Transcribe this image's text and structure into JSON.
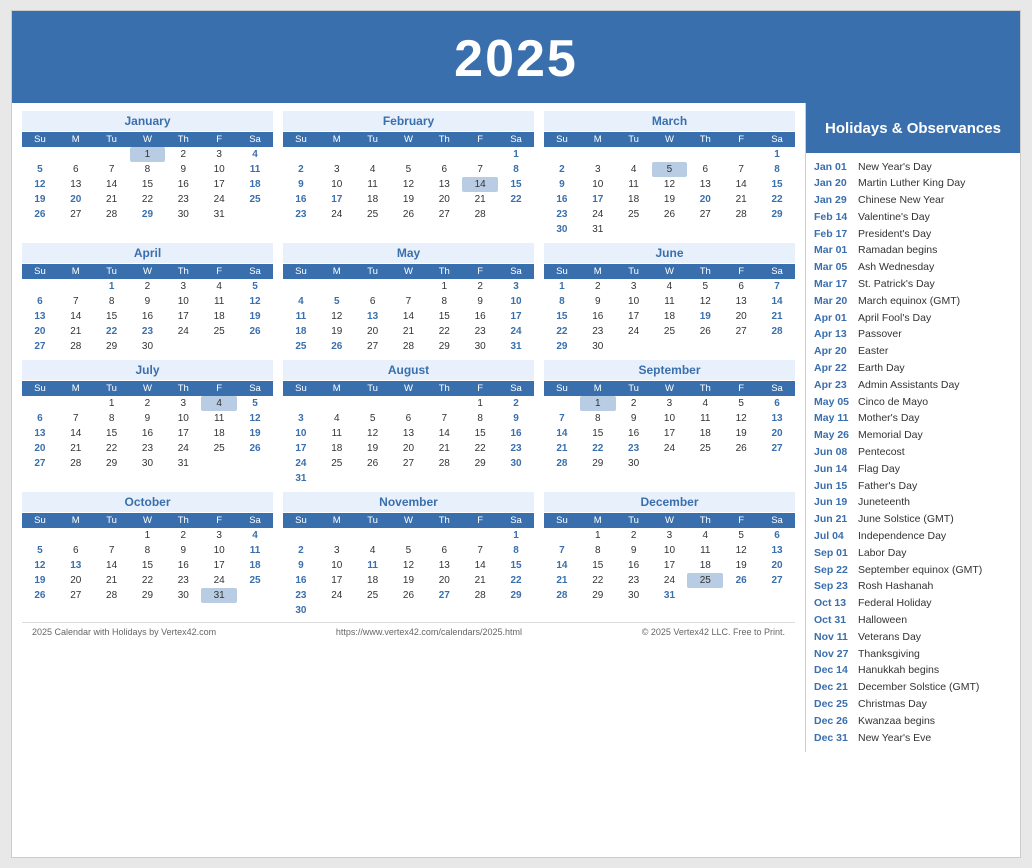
{
  "header": {
    "year": "2025"
  },
  "sidebar_header": "Holidays & Observances",
  "holidays": [
    {
      "date": "Jan 01",
      "name": "New Year's Day"
    },
    {
      "date": "Jan 20",
      "name": "Martin Luther King Day"
    },
    {
      "date": "Jan 29",
      "name": "Chinese New Year"
    },
    {
      "date": "Feb 14",
      "name": "Valentine's Day"
    },
    {
      "date": "Feb 17",
      "name": "President's Day"
    },
    {
      "date": "Mar 01",
      "name": "Ramadan begins"
    },
    {
      "date": "Mar 05",
      "name": "Ash Wednesday"
    },
    {
      "date": "Mar 17",
      "name": "St. Patrick's Day"
    },
    {
      "date": "Mar 20",
      "name": "March equinox (GMT)"
    },
    {
      "date": "Apr 01",
      "name": "April Fool's Day"
    },
    {
      "date": "Apr 13",
      "name": "Passover"
    },
    {
      "date": "Apr 20",
      "name": "Easter"
    },
    {
      "date": "Apr 22",
      "name": "Earth Day"
    },
    {
      "date": "Apr 23",
      "name": "Admin Assistants Day"
    },
    {
      "date": "May 05",
      "name": "Cinco de Mayo"
    },
    {
      "date": "May 11",
      "name": "Mother's Day"
    },
    {
      "date": "May 26",
      "name": "Memorial Day"
    },
    {
      "date": "Jun 08",
      "name": "Pentecost"
    },
    {
      "date": "Jun 14",
      "name": "Flag Day"
    },
    {
      "date": "Jun 15",
      "name": "Father's Day"
    },
    {
      "date": "Jun 19",
      "name": "Juneteenth"
    },
    {
      "date": "Jun 21",
      "name": "June Solstice (GMT)"
    },
    {
      "date": "Jul 04",
      "name": "Independence Day"
    },
    {
      "date": "Sep 01",
      "name": "Labor Day"
    },
    {
      "date": "Sep 22",
      "name": "September equinox (GMT)"
    },
    {
      "date": "Sep 23",
      "name": "Rosh Hashanah"
    },
    {
      "date": "Oct 13",
      "name": "Federal Holiday"
    },
    {
      "date": "Oct 31",
      "name": "Halloween"
    },
    {
      "date": "Nov 11",
      "name": "Veterans Day"
    },
    {
      "date": "Nov 27",
      "name": "Thanksgiving"
    },
    {
      "date": "Dec 14",
      "name": "Hanukkah begins"
    },
    {
      "date": "Dec 21",
      "name": "December Solstice (GMT)"
    },
    {
      "date": "Dec 25",
      "name": "Christmas Day"
    },
    {
      "date": "Dec 26",
      "name": "Kwanzaa begins"
    },
    {
      "date": "Dec 31",
      "name": "New Year's Eve"
    }
  ],
  "footer_left": "2025 Calendar with Holidays by Vertex42.com",
  "footer_center": "https://www.vertex42.com/calendars/2025.html",
  "footer_right": "© 2025 Vertex42 LLC. Free to Print.",
  "months": [
    {
      "name": "January",
      "weeks": [
        [
          null,
          null,
          null,
          "1h",
          "2",
          "3",
          "4"
        ],
        [
          "5",
          "6",
          "7",
          "8",
          "9",
          "10",
          "11"
        ],
        [
          "12",
          "13",
          "14",
          "15",
          "16",
          "17",
          "18"
        ],
        [
          "19",
          "20b",
          "21",
          "22",
          "23",
          "24",
          "25"
        ],
        [
          "26",
          "27",
          "28",
          "29b",
          "30",
          "31",
          null
        ]
      ]
    },
    {
      "name": "February",
      "weeks": [
        [
          null,
          null,
          null,
          null,
          null,
          null,
          "1"
        ],
        [
          "2",
          "3",
          "4",
          "5",
          "6",
          "7",
          "8"
        ],
        [
          "9",
          "10",
          "11",
          "12",
          "13",
          "14h",
          "15"
        ],
        [
          "16",
          "17b",
          "18",
          "19",
          "20",
          "21",
          "22"
        ],
        [
          "23",
          "24",
          "25",
          "26",
          "27",
          "28",
          null
        ]
      ]
    },
    {
      "name": "March",
      "weeks": [
        [
          null,
          null,
          null,
          null,
          null,
          null,
          "1s"
        ],
        [
          "2",
          "3",
          "4",
          "5h",
          "6",
          "7",
          "8"
        ],
        [
          "9",
          "10",
          "11",
          "12",
          "13",
          "14",
          "15"
        ],
        [
          "16",
          "17b",
          "18",
          "19",
          "20b",
          "21",
          "22"
        ],
        [
          "23",
          "24",
          "25",
          "26",
          "27",
          "28",
          "29"
        ],
        [
          "30",
          "31",
          null,
          null,
          null,
          null,
          null
        ]
      ]
    },
    {
      "name": "April",
      "weeks": [
        [
          null,
          null,
          "1b",
          "2",
          "3",
          "4",
          "5"
        ],
        [
          "6",
          "7",
          "8",
          "9",
          "10",
          "11",
          "12"
        ],
        [
          "13",
          "14",
          "15",
          "16",
          "17",
          "18",
          "19"
        ],
        [
          "20b",
          "21",
          "22b",
          "23b",
          "24",
          "25",
          "26"
        ],
        [
          "27",
          "28",
          "29",
          "30",
          null,
          null,
          null
        ]
      ]
    },
    {
      "name": "May",
      "weeks": [
        [
          null,
          null,
          null,
          null,
          "1",
          "2",
          "3s"
        ],
        [
          "4b",
          "5b",
          "6",
          "7",
          "8",
          "9",
          "10"
        ],
        [
          "11",
          "12",
          "13b",
          "14",
          "15",
          "16",
          "17"
        ],
        [
          "18",
          "19",
          "20",
          "21",
          "22",
          "23",
          "24"
        ],
        [
          "25",
          "26b",
          "27",
          "28",
          "29",
          "30",
          "31"
        ]
      ]
    },
    {
      "name": "June",
      "weeks": [
        [
          "1",
          "2",
          "3",
          "4",
          "5",
          "6",
          "7s"
        ],
        [
          "8b",
          "9",
          "10",
          "11",
          "12",
          "13",
          "14s"
        ],
        [
          "15",
          "16",
          "17",
          "18",
          "19b",
          "20",
          "21b"
        ],
        [
          "22",
          "23",
          "24",
          "25",
          "26",
          "27",
          "28"
        ],
        [
          "29",
          "30",
          null,
          null,
          null,
          null,
          null
        ]
      ]
    },
    {
      "name": "July",
      "weeks": [
        [
          null,
          null,
          "1",
          "2",
          "3",
          "4h",
          "5s"
        ],
        [
          "6",
          "7",
          "8",
          "9",
          "10",
          "11",
          "12"
        ],
        [
          "13",
          "14",
          "15",
          "16",
          "17",
          "18",
          "19"
        ],
        [
          "20",
          "21",
          "22",
          "23",
          "24",
          "25",
          "26"
        ],
        [
          "27",
          "28",
          "29",
          "30",
          "31",
          null,
          null
        ]
      ]
    },
    {
      "name": "August",
      "weeks": [
        [
          null,
          null,
          null,
          null,
          null,
          "1",
          "2s"
        ],
        [
          "3",
          "4",
          "5",
          "6",
          "7",
          "8",
          "9"
        ],
        [
          "10",
          "11",
          "12",
          "13",
          "14",
          "15",
          "16"
        ],
        [
          "17",
          "18",
          "19",
          "20",
          "21",
          "22",
          "23"
        ],
        [
          "24",
          "25",
          "26",
          "27",
          "28",
          "29",
          "30"
        ],
        [
          "31",
          null,
          null,
          null,
          null,
          null,
          null
        ]
      ]
    },
    {
      "name": "September",
      "weeks": [
        [
          null,
          "1h",
          "2",
          "3",
          "4",
          "5",
          "6s"
        ],
        [
          "7",
          "8",
          "9",
          "10",
          "11",
          "12",
          "13"
        ],
        [
          "14",
          "15",
          "16",
          "17",
          "18",
          "19",
          "20s"
        ],
        [
          "21",
          "22b",
          "23b",
          "24",
          "25",
          "26",
          "27"
        ],
        [
          "28",
          "29",
          "30",
          null,
          null,
          null,
          null
        ]
      ]
    },
    {
      "name": "October",
      "weeks": [
        [
          null,
          null,
          null,
          "1",
          "2",
          "3",
          "4s"
        ],
        [
          "5",
          "6",
          "7",
          "8",
          "9",
          "10",
          "11"
        ],
        [
          "12",
          "13b",
          "14",
          "15",
          "16",
          "17",
          "18"
        ],
        [
          "19",
          "20",
          "21",
          "22",
          "23",
          "24",
          "25"
        ],
        [
          "26",
          "27",
          "28",
          "29",
          "30",
          "31h",
          null
        ]
      ]
    },
    {
      "name": "November",
      "weeks": [
        [
          null,
          null,
          null,
          null,
          null,
          null,
          "1s"
        ],
        [
          "2",
          "3",
          "4",
          "5",
          "6",
          "7",
          "8"
        ],
        [
          "9",
          "10",
          "11b",
          "12",
          "13",
          "14",
          "15"
        ],
        [
          "16",
          "17",
          "18",
          "19",
          "20",
          "21",
          "22"
        ],
        [
          "23",
          "24",
          "25",
          "26",
          "27b",
          "28",
          "29"
        ],
        [
          "30",
          null,
          null,
          null,
          null,
          null,
          null
        ]
      ]
    },
    {
      "name": "December",
      "weeks": [
        [
          null,
          "1",
          "2",
          "3",
          "4",
          "5",
          "6s"
        ],
        [
          "7",
          "8",
          "9",
          "10",
          "11",
          "12",
          "13"
        ],
        [
          "14b",
          "15",
          "16",
          "17",
          "18",
          "19",
          "20"
        ],
        [
          "21b",
          "22",
          "23",
          "24",
          "25h",
          "26b",
          "27"
        ],
        [
          "28",
          "29",
          "30",
          "31b",
          null,
          null,
          null
        ]
      ]
    }
  ]
}
